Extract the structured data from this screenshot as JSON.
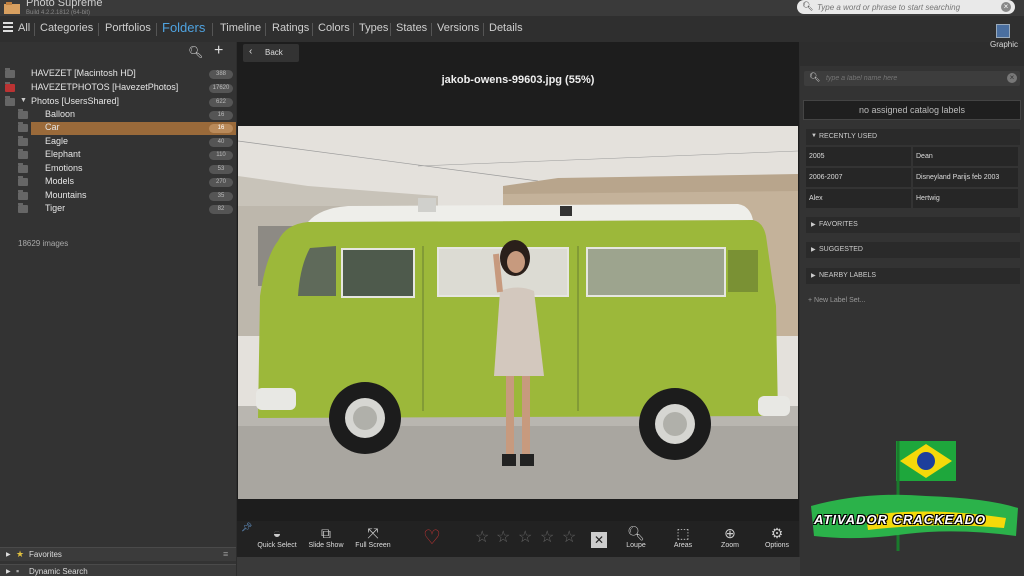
{
  "app": {
    "title": "Photo Supreme",
    "version": "Build 4.2.2.1812 (64-bit)",
    "search_placeholder": "Type a word or phrase to start searching"
  },
  "nav": {
    "tabs": [
      {
        "label": "All"
      },
      {
        "label": "Categories"
      },
      {
        "label": "Portfolios"
      },
      {
        "label": "Folders",
        "active": true
      },
      {
        "label": "Timeline"
      },
      {
        "label": "Ratings"
      },
      {
        "label": "Colors"
      },
      {
        "label": "Types"
      },
      {
        "label": "States"
      },
      {
        "label": "Versions"
      },
      {
        "label": "Details"
      }
    ],
    "graphic_label": "Graphic"
  },
  "folders": {
    "items": [
      {
        "label": "HAVEZET  [Macintosh HD]",
        "count": "388"
      },
      {
        "label": "HAVEZETPHOTOS  [HavezetPhotos]",
        "count": "17620"
      },
      {
        "label": "Photos  [UsersShared]",
        "count": "622"
      },
      {
        "label": "Balloon",
        "count": "16"
      },
      {
        "label": "Car",
        "count": "16"
      },
      {
        "label": "Eagle",
        "count": "40"
      },
      {
        "label": "Elephant",
        "count": "110"
      },
      {
        "label": "Emotions",
        "count": "53"
      },
      {
        "label": "Models",
        "count": "270"
      },
      {
        "label": "Mountains",
        "count": "35"
      },
      {
        "label": "Tiger",
        "count": "82"
      }
    ],
    "image_count": "18629 images"
  },
  "left_footer": {
    "favorites": "Favorites",
    "dynamic_search": "Dynamic Search"
  },
  "viewer": {
    "back_label": "Back",
    "image_title": "jakob-owens-99603.jpg (55%)"
  },
  "toolbar": {
    "quick_select": "Quick Select",
    "slide_show": "Slide Show",
    "full_screen": "Full Screen",
    "loupe": "Loupe",
    "areas": "Areas",
    "zoom": "Zoom",
    "options": "Options",
    "rating": 0
  },
  "labels": {
    "search_placeholder": "type a label name here",
    "no_assigned": "no assigned catalog labels",
    "recently_used_title": "RECENTLY USED",
    "recently_used": [
      [
        "2005",
        "Dean"
      ],
      [
        "2006-2007",
        "Disneyland Parijs feb 2003"
      ],
      [
        "Alex",
        "Hertwig"
      ]
    ],
    "favorites_title": "FAVORITES",
    "suggested_title": "SUGGESTED",
    "nearby_title": "NEARBY LABELS",
    "new_label_set": "New Label Set..."
  },
  "watermark": {
    "text": "ATIVADOR CRACKEADO"
  },
  "colors": {
    "accent": "#4fa3e0",
    "selection": "#9a6a3a",
    "van": "#9cb83a"
  }
}
